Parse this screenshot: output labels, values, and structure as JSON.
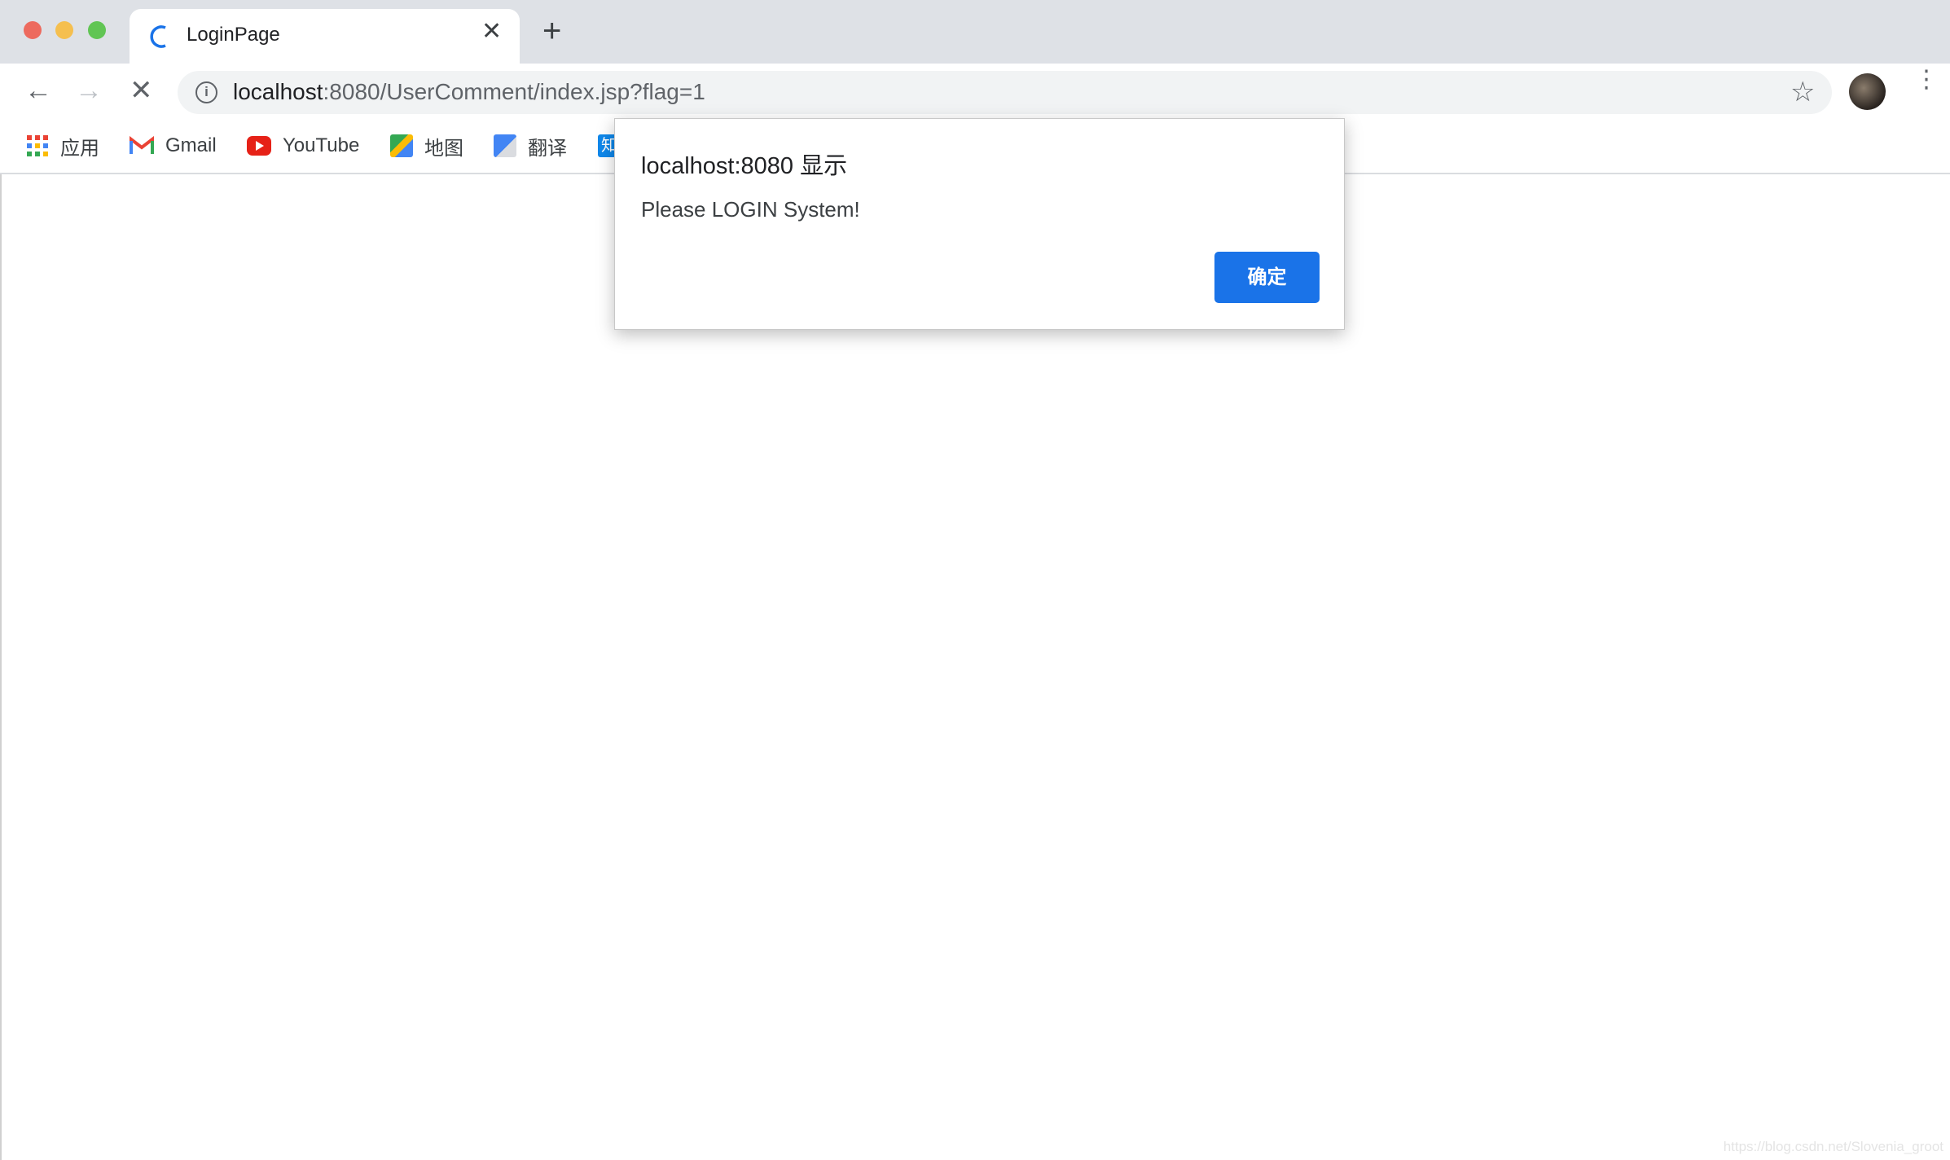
{
  "window": {
    "traffic_lights": [
      "#ed6a5e",
      "#f5bf4f",
      "#61c554"
    ]
  },
  "tab": {
    "title": "LoginPage",
    "close": "✕",
    "new_tab": "+"
  },
  "toolbar": {
    "back": "←",
    "forward": "→",
    "stop": "✕",
    "info": "i",
    "url_host": "localhost",
    "url_rest": ":8080/UserComment/index.jsp?flag=1",
    "star": "☆",
    "menu": "⋮"
  },
  "bookmarks": [
    {
      "label": "应用",
      "icon": "apps-grid-icon"
    },
    {
      "label": "Gmail",
      "icon": "gmail-icon"
    },
    {
      "label": "YouTube",
      "icon": "youtube-icon"
    },
    {
      "label": "地图",
      "icon": "maps-icon"
    },
    {
      "label": "翻译",
      "icon": "translate-icon"
    },
    {
      "label": "知",
      "icon": "zhihu-icon"
    }
  ],
  "dialog": {
    "title": "localhost:8080 显示",
    "message": "Please LOGIN System!",
    "ok_label": "确定",
    "accent": "#1a73e8"
  },
  "watermark": "https://blog.csdn.net/Slovenia_groot"
}
